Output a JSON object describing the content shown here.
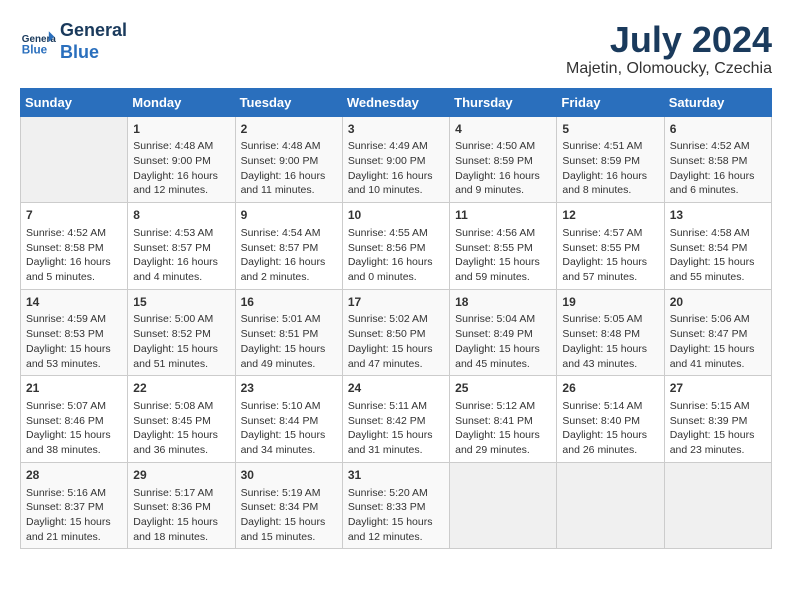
{
  "header": {
    "logo_line1": "General",
    "logo_line2": "Blue",
    "month_year": "July 2024",
    "location": "Majetin, Olomoucky, Czechia"
  },
  "weekdays": [
    "Sunday",
    "Monday",
    "Tuesday",
    "Wednesday",
    "Thursday",
    "Friday",
    "Saturday"
  ],
  "weeks": [
    [
      {
        "day": "",
        "content": ""
      },
      {
        "day": "1",
        "content": "Sunrise: 4:48 AM\nSunset: 9:00 PM\nDaylight: 16 hours and 12 minutes."
      },
      {
        "day": "2",
        "content": "Sunrise: 4:48 AM\nSunset: 9:00 PM\nDaylight: 16 hours and 11 minutes."
      },
      {
        "day": "3",
        "content": "Sunrise: 4:49 AM\nSunset: 9:00 PM\nDaylight: 16 hours and 10 minutes."
      },
      {
        "day": "4",
        "content": "Sunrise: 4:50 AM\nSunset: 8:59 PM\nDaylight: 16 hours and 9 minutes."
      },
      {
        "day": "5",
        "content": "Sunrise: 4:51 AM\nSunset: 8:59 PM\nDaylight: 16 hours and 8 minutes."
      },
      {
        "day": "6",
        "content": "Sunrise: 4:52 AM\nSunset: 8:58 PM\nDaylight: 16 hours and 6 minutes."
      }
    ],
    [
      {
        "day": "7",
        "content": "Sunrise: 4:52 AM\nSunset: 8:58 PM\nDaylight: 16 hours and 5 minutes."
      },
      {
        "day": "8",
        "content": "Sunrise: 4:53 AM\nSunset: 8:57 PM\nDaylight: 16 hours and 4 minutes."
      },
      {
        "day": "9",
        "content": "Sunrise: 4:54 AM\nSunset: 8:57 PM\nDaylight: 16 hours and 2 minutes."
      },
      {
        "day": "10",
        "content": "Sunrise: 4:55 AM\nSunset: 8:56 PM\nDaylight: 16 hours and 0 minutes."
      },
      {
        "day": "11",
        "content": "Sunrise: 4:56 AM\nSunset: 8:55 PM\nDaylight: 15 hours and 59 minutes."
      },
      {
        "day": "12",
        "content": "Sunrise: 4:57 AM\nSunset: 8:55 PM\nDaylight: 15 hours and 57 minutes."
      },
      {
        "day": "13",
        "content": "Sunrise: 4:58 AM\nSunset: 8:54 PM\nDaylight: 15 hours and 55 minutes."
      }
    ],
    [
      {
        "day": "14",
        "content": "Sunrise: 4:59 AM\nSunset: 8:53 PM\nDaylight: 15 hours and 53 minutes."
      },
      {
        "day": "15",
        "content": "Sunrise: 5:00 AM\nSunset: 8:52 PM\nDaylight: 15 hours and 51 minutes."
      },
      {
        "day": "16",
        "content": "Sunrise: 5:01 AM\nSunset: 8:51 PM\nDaylight: 15 hours and 49 minutes."
      },
      {
        "day": "17",
        "content": "Sunrise: 5:02 AM\nSunset: 8:50 PM\nDaylight: 15 hours and 47 minutes."
      },
      {
        "day": "18",
        "content": "Sunrise: 5:04 AM\nSunset: 8:49 PM\nDaylight: 15 hours and 45 minutes."
      },
      {
        "day": "19",
        "content": "Sunrise: 5:05 AM\nSunset: 8:48 PM\nDaylight: 15 hours and 43 minutes."
      },
      {
        "day": "20",
        "content": "Sunrise: 5:06 AM\nSunset: 8:47 PM\nDaylight: 15 hours and 41 minutes."
      }
    ],
    [
      {
        "day": "21",
        "content": "Sunrise: 5:07 AM\nSunset: 8:46 PM\nDaylight: 15 hours and 38 minutes."
      },
      {
        "day": "22",
        "content": "Sunrise: 5:08 AM\nSunset: 8:45 PM\nDaylight: 15 hours and 36 minutes."
      },
      {
        "day": "23",
        "content": "Sunrise: 5:10 AM\nSunset: 8:44 PM\nDaylight: 15 hours and 34 minutes."
      },
      {
        "day": "24",
        "content": "Sunrise: 5:11 AM\nSunset: 8:42 PM\nDaylight: 15 hours and 31 minutes."
      },
      {
        "day": "25",
        "content": "Sunrise: 5:12 AM\nSunset: 8:41 PM\nDaylight: 15 hours and 29 minutes."
      },
      {
        "day": "26",
        "content": "Sunrise: 5:14 AM\nSunset: 8:40 PM\nDaylight: 15 hours and 26 minutes."
      },
      {
        "day": "27",
        "content": "Sunrise: 5:15 AM\nSunset: 8:39 PM\nDaylight: 15 hours and 23 minutes."
      }
    ],
    [
      {
        "day": "28",
        "content": "Sunrise: 5:16 AM\nSunset: 8:37 PM\nDaylight: 15 hours and 21 minutes."
      },
      {
        "day": "29",
        "content": "Sunrise: 5:17 AM\nSunset: 8:36 PM\nDaylight: 15 hours and 18 minutes."
      },
      {
        "day": "30",
        "content": "Sunrise: 5:19 AM\nSunset: 8:34 PM\nDaylight: 15 hours and 15 minutes."
      },
      {
        "day": "31",
        "content": "Sunrise: 5:20 AM\nSunset: 8:33 PM\nDaylight: 15 hours and 12 minutes."
      },
      {
        "day": "",
        "content": ""
      },
      {
        "day": "",
        "content": ""
      },
      {
        "day": "",
        "content": ""
      }
    ]
  ]
}
